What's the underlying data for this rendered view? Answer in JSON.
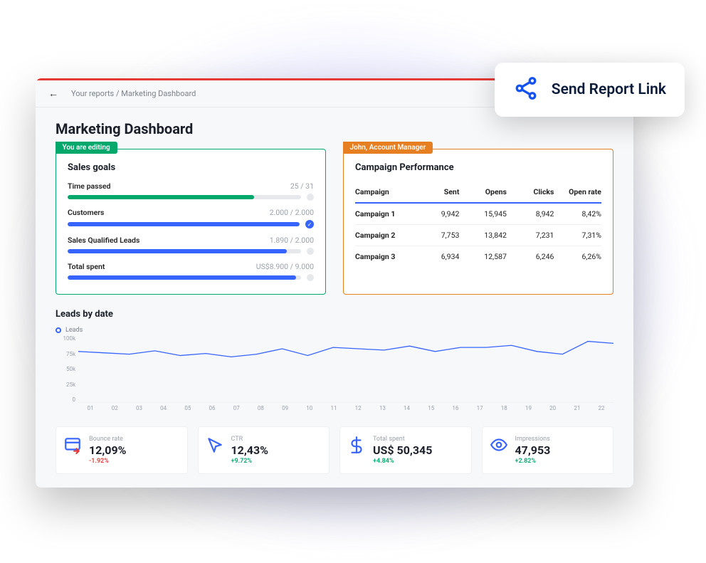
{
  "breadcrumb": "Your reports / Marketing Dashboard",
  "page_title": "Marketing Dashboard",
  "share_popup_text": "Send Report Link",
  "colors": {
    "accent_blue": "#3764ff",
    "green": "#00a86b",
    "orange": "#e67e22",
    "red": "#e53935"
  },
  "goals_card": {
    "badge": "You are editing",
    "title": "Sales goals",
    "items": [
      {
        "label": "Time passed",
        "value": "25 / 31",
        "percent": 80,
        "color": "green",
        "checked": false
      },
      {
        "label": "Customers",
        "value": "2.000 / 2.000",
        "percent": 100,
        "color": "blue",
        "checked": true
      },
      {
        "label": "Sales Qualified Leads",
        "value": "1.890 / 2.000",
        "percent": 94,
        "color": "blue",
        "checked": false
      },
      {
        "label": "Total spent",
        "value": "US$8.900 / 9.000",
        "percent": 98,
        "color": "blue",
        "checked": false
      }
    ]
  },
  "performance_card": {
    "badge": "John, Account Manager",
    "title": "Campaign Performance",
    "columns": [
      "Campaign",
      "Sent",
      "Opens",
      "Clicks",
      "Open rate"
    ],
    "rows": [
      {
        "campaign": "Campaign 1",
        "sent": "9,942",
        "opens": "15,945",
        "clicks": "8,942",
        "open_rate": "8,42%"
      },
      {
        "campaign": "Campaign 2",
        "sent": "7,753",
        "opens": "13,842",
        "clicks": "7,231",
        "open_rate": "7,31%"
      },
      {
        "campaign": "Campaign 3",
        "sent": "6,934",
        "opens": "12,587",
        "clicks": "6,246",
        "open_rate": "6,26%"
      }
    ]
  },
  "leads_chart": {
    "title": "Leads by date",
    "legend": "Leads"
  },
  "chart_data": {
    "type": "line",
    "series": [
      {
        "name": "Leads",
        "values": [
          76,
          74,
          72,
          77,
          70,
          73,
          68,
          72,
          80,
          70,
          82,
          80,
          78,
          84,
          76,
          82,
          82,
          85,
          76,
          72,
          91,
          88
        ]
      }
    ],
    "categories": [
      "01",
      "02",
      "03",
      "04",
      "05",
      "06",
      "07",
      "08",
      "09",
      "10",
      "11",
      "12",
      "13",
      "14",
      "15",
      "16",
      "17",
      "18",
      "19",
      "20",
      "21",
      "22"
    ],
    "xlabel": "",
    "ylabel": "",
    "y_ticks": [
      "100k",
      "75k",
      "50k",
      "25k",
      "0"
    ],
    "ylim": [
      0,
      100
    ]
  },
  "stats": [
    {
      "icon": "bounce-icon",
      "label": "Bounce rate",
      "value": "12,09%",
      "delta": "-1.92%",
      "direction": "down"
    },
    {
      "icon": "cursor-icon",
      "label": "CTR",
      "value": "12,43%",
      "delta": "+9.72%",
      "direction": "up"
    },
    {
      "icon": "dollar-icon",
      "label": "Total spent",
      "value": "US$ 50,345",
      "delta": "+4.84%",
      "direction": "up"
    },
    {
      "icon": "eye-icon",
      "label": "Impressions",
      "value": "47,953",
      "delta": "+2.82%",
      "direction": "up"
    }
  ]
}
